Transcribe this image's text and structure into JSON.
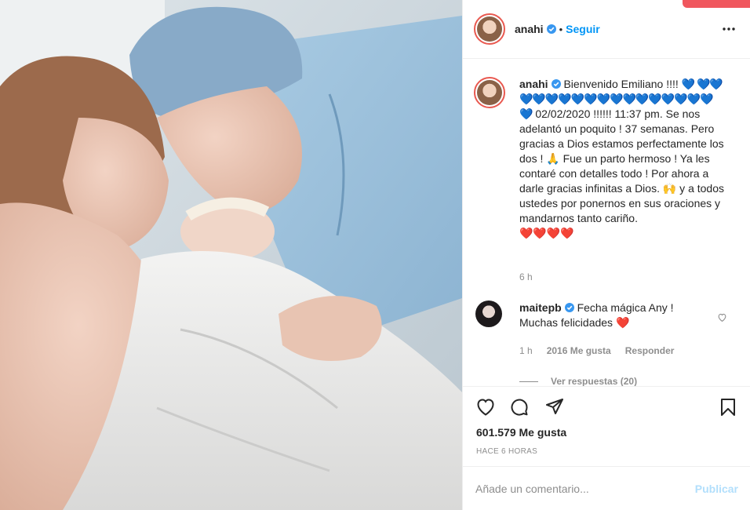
{
  "colors": {
    "accent": "#0095f6",
    "heart_red": "#ed4956",
    "blue_heart": "#1e88e5",
    "muted": "#8e8e8e",
    "publish_disabled": "#b2dffc"
  },
  "header": {
    "username": "anahi",
    "separator": "•",
    "follow_label": "Seguir",
    "more_icon": "ellipsis-icon"
  },
  "caption": {
    "username": "anahi",
    "text_lead": "Bienvenido Emiliano !!!! ",
    "hearts_blue_line": "💙 💙💙💙💙💙💙💙💙💙💙💙💙💙💙💙💙💙💙",
    "date_line": " 02/02/2020 !!!!!! 11:37 pm. Se nos adelantó un poquito ! 37 semanas. Pero gracias a Dios estamos perfectamente los dos ! 🙏 Fue un parto hermoso ! Ya les contaré con detalles todo ! Por ahora a darle gracias infinitas a Dios. 🙌 y a todos ustedes por ponernos en sus oraciones y mandarnos tanto cariño.",
    "hearts_red": "❤️❤️❤️❤️",
    "time": "6 h"
  },
  "comment": {
    "username": "maitepb",
    "text": " Fecha mágica Any ! Muchas felicidades ",
    "heart": "❤️",
    "time": "1 h",
    "likes": "2016 Me gusta",
    "reply_label": "Responder",
    "view_replies": "Ver respuestas (20)"
  },
  "actions": {
    "like_icon": "heart-icon",
    "comment_icon": "comment-icon",
    "share_icon": "share-icon",
    "save_icon": "bookmark-icon"
  },
  "likes_count": "601.579 Me gusta",
  "time_ago": "HACE 6 HORAS",
  "add_comment": {
    "placeholder": "Añade un comentario...",
    "publish_label": "Publicar"
  }
}
